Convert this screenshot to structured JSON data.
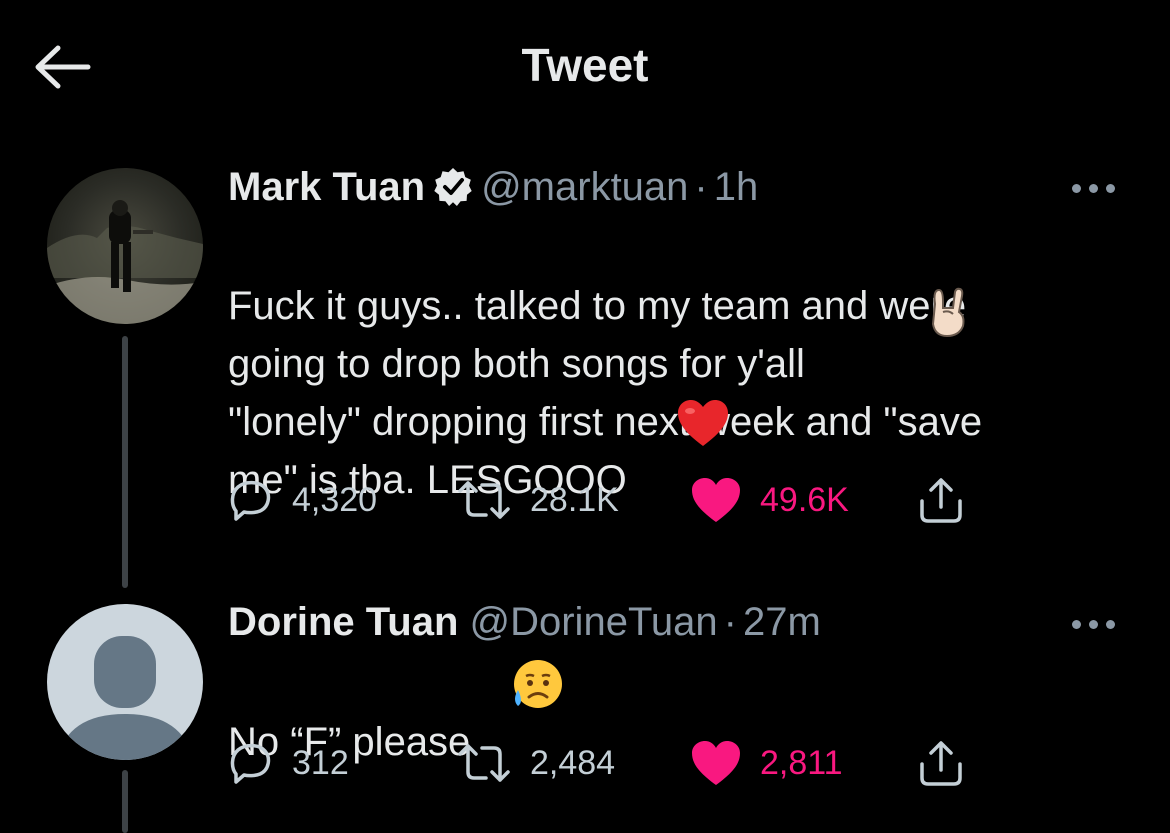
{
  "header": {
    "title": "Tweet"
  },
  "tweets": [
    {
      "author": {
        "name": "Mark Tuan",
        "handle": "@marktuan",
        "verified": true
      },
      "separator": "·",
      "time": "1h",
      "text": "Fuck it guys.. talked to my team and were\ngoing to drop both songs for y'all\n\"lonely\" dropping first next week and \"save\nme\" is tba. LESGOOO",
      "emojis": [
        "rock-on-hand-emoji",
        "red-heart-emoji"
      ],
      "stats": {
        "replies": "4,320",
        "retweets": "28.1K",
        "likes": "49.6K"
      },
      "liked": true
    },
    {
      "author": {
        "name": "Dorine Tuan",
        "handle": "@DorineTuan",
        "verified": false
      },
      "separator": "·",
      "time": "27m",
      "text": "No “F” please",
      "emojis": [
        "sad-relieved-face-emoji"
      ],
      "stats": {
        "replies": "312",
        "retweets": "2,484",
        "likes": "2,811"
      },
      "liked": true
    }
  ],
  "colors": {
    "background": "#000000",
    "text": "#e7e9ea",
    "muted": "#8b98a5",
    "like": "#f91880",
    "verified": "#e7e9ea"
  }
}
